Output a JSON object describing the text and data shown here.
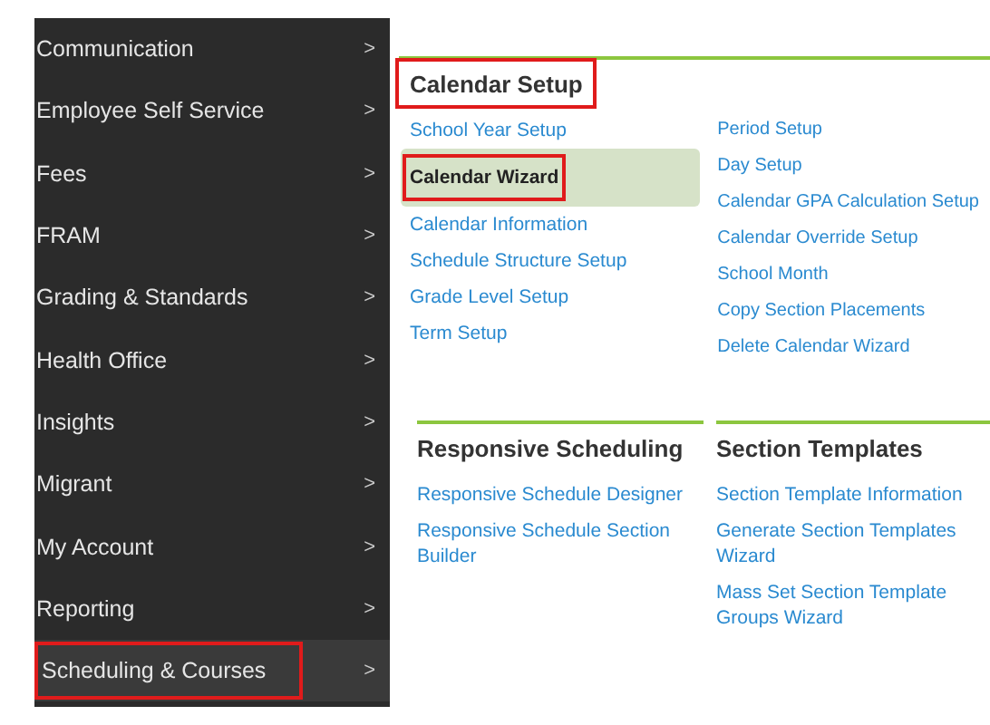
{
  "sidebar": {
    "items": [
      {
        "label": "Communication",
        "selected": false,
        "highlighted": false
      },
      {
        "label": "Employee Self Service",
        "selected": false,
        "highlighted": false
      },
      {
        "label": "Fees",
        "selected": false,
        "highlighted": false
      },
      {
        "label": "FRAM",
        "selected": false,
        "highlighted": false
      },
      {
        "label": "Grading & Standards",
        "selected": false,
        "highlighted": false
      },
      {
        "label": "Health Office",
        "selected": false,
        "highlighted": false
      },
      {
        "label": "Insights",
        "selected": false,
        "highlighted": false
      },
      {
        "label": "Migrant",
        "selected": false,
        "highlighted": false
      },
      {
        "label": "My Account",
        "selected": false,
        "highlighted": false
      },
      {
        "label": "Reporting",
        "selected": false,
        "highlighted": false
      },
      {
        "label": "Scheduling & Courses",
        "selected": true,
        "highlighted": true
      }
    ],
    "chevron": ">"
  },
  "sections": [
    {
      "title": "Calendar Setup",
      "highlighted": true,
      "columns": [
        [
          {
            "label": "School Year Setup",
            "selected": false,
            "highlighted": false
          },
          {
            "label": "Calendar Wizard",
            "selected": true,
            "highlighted": true
          },
          {
            "label": "Calendar Information",
            "selected": false,
            "highlighted": false
          },
          {
            "label": "Schedule Structure Setup",
            "selected": false,
            "highlighted": false
          },
          {
            "label": "Grade Level Setup",
            "selected": false,
            "highlighted": false
          },
          {
            "label": "Term Setup",
            "selected": false,
            "highlighted": false
          }
        ],
        [
          {
            "label": "Period Setup",
            "selected": false,
            "highlighted": false
          },
          {
            "label": "Day Setup",
            "selected": false,
            "highlighted": false
          },
          {
            "label": "Calendar GPA Calculation Setup",
            "selected": false,
            "highlighted": false
          },
          {
            "label": "Calendar Override Setup",
            "selected": false,
            "highlighted": false
          },
          {
            "label": "School Month",
            "selected": false,
            "highlighted": false
          },
          {
            "label": "Copy Section Placements",
            "selected": false,
            "highlighted": false
          },
          {
            "label": "Delete Calendar Wizard",
            "selected": false,
            "highlighted": false
          }
        ]
      ]
    },
    {
      "title": "Responsive Scheduling",
      "highlighted": false,
      "columns": [
        [
          {
            "label": "Responsive Schedule Designer",
            "selected": false,
            "highlighted": false
          },
          {
            "label": "Responsive Schedule Section Builder",
            "selected": false,
            "highlighted": false
          }
        ]
      ]
    },
    {
      "title": "Section Templates",
      "highlighted": false,
      "columns": [
        [
          {
            "label": "Section Template Information",
            "selected": false,
            "highlighted": false
          },
          {
            "label": "Generate Section Templates Wizard",
            "selected": false,
            "highlighted": false
          },
          {
            "label": "Mass Set Section Template Groups Wizard",
            "selected": false,
            "highlighted": false
          }
        ]
      ]
    }
  ]
}
